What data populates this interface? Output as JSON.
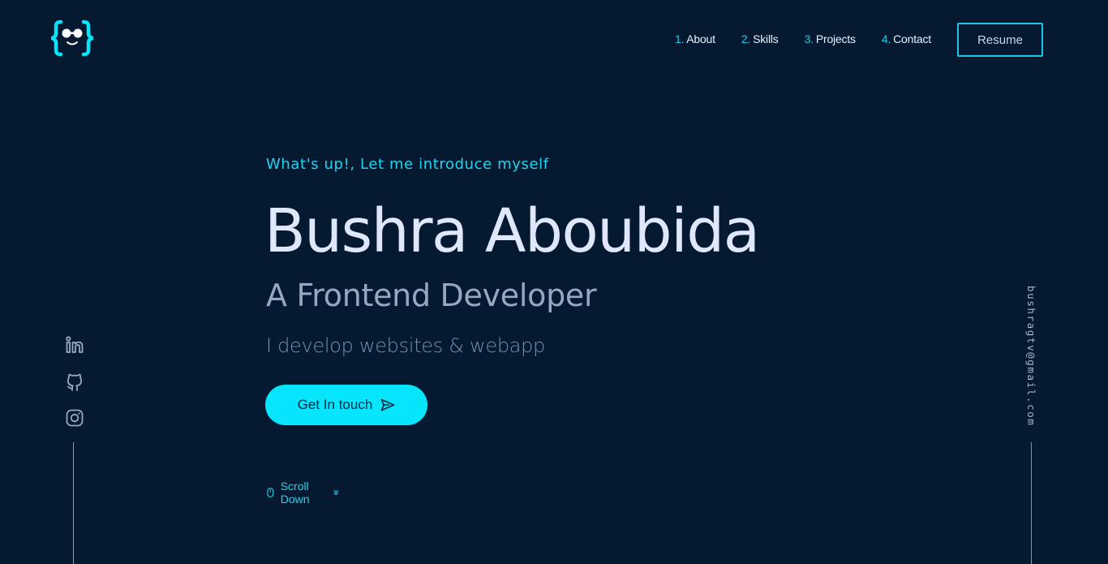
{
  "header": {
    "logo": "curly-braces-face-logo",
    "nav": [
      {
        "num": "1.",
        "label": "About"
      },
      {
        "num": "2.",
        "label": "Skills"
      },
      {
        "num": "3.",
        "label": "Projects"
      },
      {
        "num": "4.",
        "label": "Contact"
      }
    ],
    "resume_label": "Resume"
  },
  "hero": {
    "intro": "What's up!, Let me introduce myself",
    "name": "Bushra Aboubida",
    "role": "A Frontend Developer",
    "tagline": "I develop websites & webapp",
    "cta_label": "Get In touch",
    "scroll_label": "Scroll Down"
  },
  "socials": {
    "items": [
      "linkedin-icon",
      "github-icon",
      "instagram-icon"
    ]
  },
  "side": {
    "email": "bushragtv@gmail.com"
  },
  "colors": {
    "background": "#051a31",
    "accent": "#06e5fb",
    "heading": "#dfe7fb",
    "muted": "#98a6c4"
  }
}
